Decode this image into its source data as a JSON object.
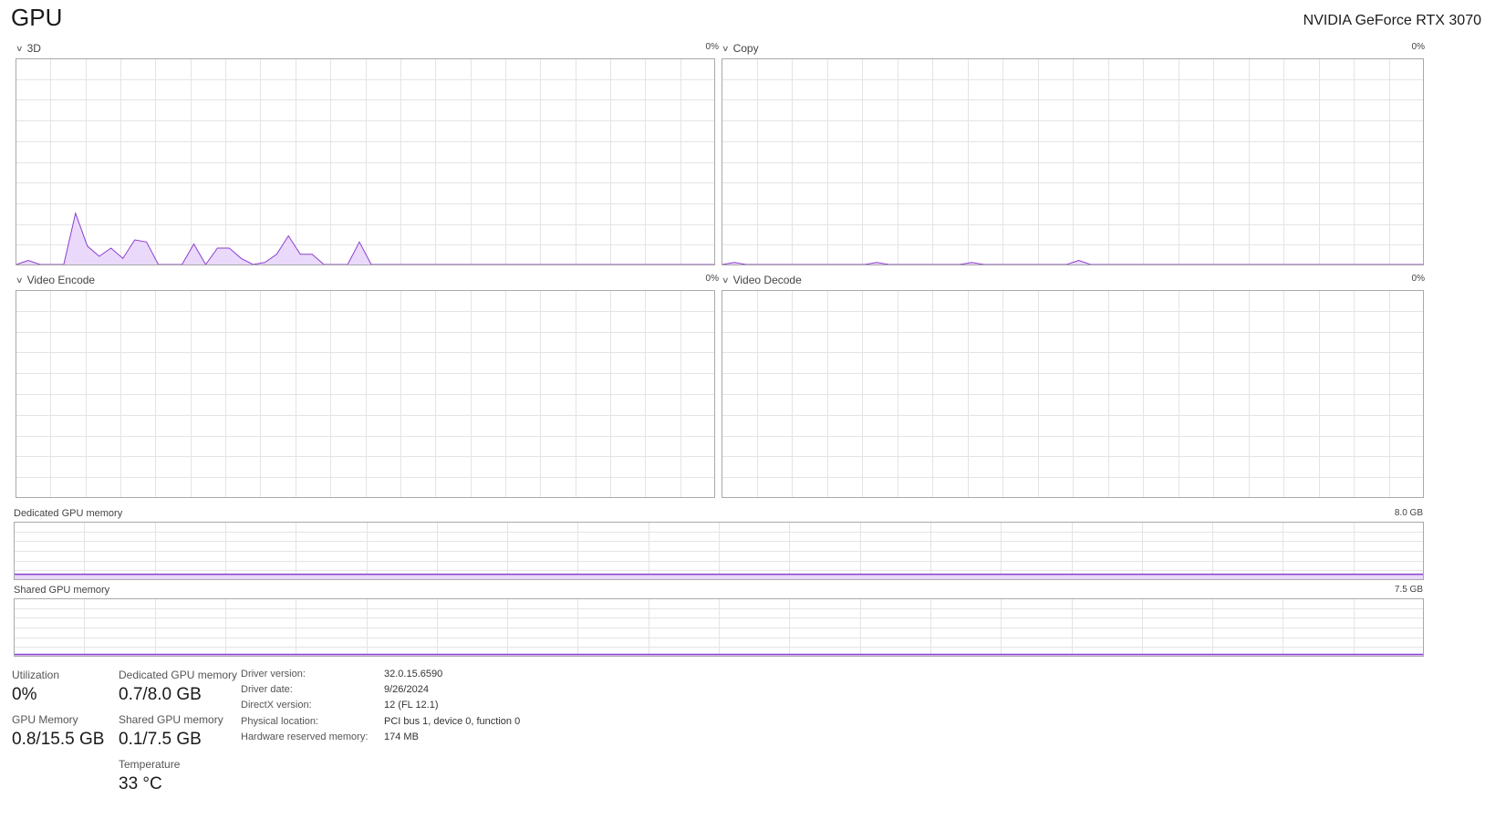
{
  "header": {
    "title": "GPU",
    "device": "NVIDIA GeForce RTX 3070"
  },
  "colors": {
    "accent": "#8b3fcf",
    "fill": "#ead9fa",
    "grid": "#e4e4e4",
    "border": "#a9a9a9"
  },
  "graphs": {
    "g3d": {
      "name": "3D",
      "max": "0%",
      "values": [
        0,
        2,
        0,
        0,
        0,
        25,
        9,
        4,
        8,
        3,
        12,
        11,
        0,
        0,
        0,
        10,
        0,
        8,
        8,
        3,
        0,
        1,
        5,
        14,
        5,
        5,
        0,
        0,
        0,
        11,
        0,
        0,
        0,
        0,
        0,
        0,
        0,
        0,
        0,
        0,
        0,
        0,
        0,
        0,
        0,
        0,
        0,
        0,
        0,
        0,
        0,
        0,
        0,
        0,
        0,
        0,
        0,
        0,
        0,
        0
      ]
    },
    "copy": {
      "name": "Copy",
      "max": "0%",
      "values": [
        0,
        1,
        0,
        0,
        0,
        0,
        0,
        0,
        0,
        0,
        0,
        0,
        0,
        1,
        0,
        0,
        0,
        0,
        0,
        0,
        0,
        1,
        0,
        0,
        0,
        0,
        0,
        0,
        0,
        0,
        2,
        0,
        0,
        0,
        0,
        0,
        0,
        0,
        0,
        0,
        0,
        0,
        0,
        0,
        0,
        0,
        0,
        0,
        0,
        0,
        0,
        0,
        0,
        0,
        0,
        0,
        0,
        0,
        0,
        0
      ]
    },
    "encode": {
      "name": "Video Encode",
      "max": "0%",
      "values": []
    },
    "decode": {
      "name": "Video Decode",
      "max": "0%",
      "values": []
    }
  },
  "memory": {
    "dedicated": {
      "label": "Dedicated GPU memory",
      "max": "8.0 GB",
      "fraction": 0.0875
    },
    "shared": {
      "label": "Shared GPU memory",
      "max": "7.5 GB",
      "fraction": 0.013
    }
  },
  "stats": {
    "utilization": {
      "label": "Utilization",
      "value": "0%"
    },
    "gpu_memory": {
      "label": "GPU Memory",
      "value": "0.8/15.5 GB"
    },
    "dedicated": {
      "label": "Dedicated GPU memory",
      "value": "0.7/8.0 GB"
    },
    "shared": {
      "label": "Shared GPU memory",
      "value": "0.1/7.5 GB"
    },
    "temperature": {
      "label": "Temperature",
      "value": "33 °C"
    }
  },
  "details": {
    "driver_version": {
      "label": "Driver version:",
      "value": "32.0.15.6590"
    },
    "driver_date": {
      "label": "Driver date:",
      "value": "9/26/2024"
    },
    "directx_version": {
      "label": "DirectX version:",
      "value": "12 (FL 12.1)"
    },
    "physical_location": {
      "label": "Physical location:",
      "value": "PCI bus 1, device 0, function 0"
    },
    "hw_reserved": {
      "label": "Hardware reserved memory:",
      "value": "174 MB"
    }
  }
}
